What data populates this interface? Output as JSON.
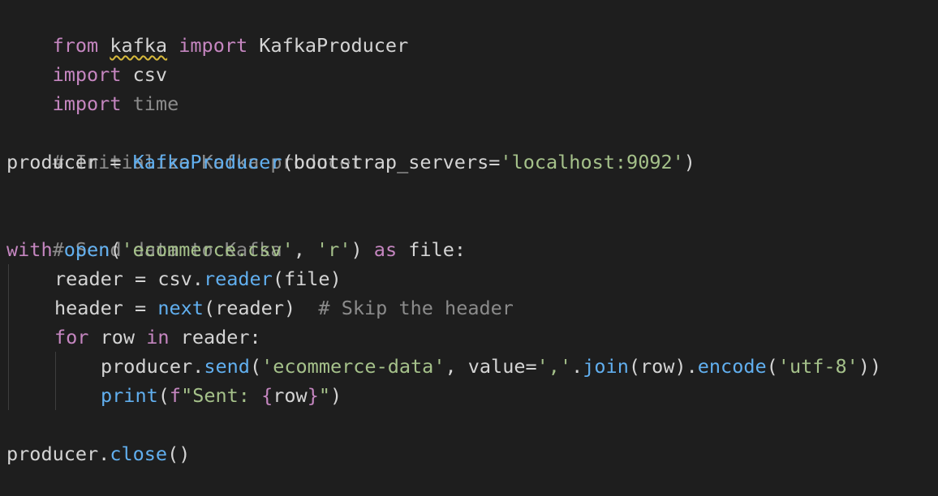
{
  "code": {
    "line1": {
      "from": "from",
      "module": "kafka",
      "import": "import",
      "name": "KafkaProducer"
    },
    "line2": {
      "import": "import",
      "module": "csv"
    },
    "line3": {
      "import": "import",
      "module": "time"
    },
    "line5": {
      "comment": "# Initialize Kafka producer"
    },
    "line6": {
      "var": "producer",
      "eq": " = ",
      "cls": "KafkaProducer",
      "open": "(",
      "arg": "bootstrap_servers",
      "eq2": "=",
      "str": "'localhost:9092'",
      "close": ")"
    },
    "line8": {
      "comment": "# Send data to Kafka"
    },
    "line9": {
      "with": "with",
      "open_fn": "open",
      "p1": "(",
      "str1": "'ecommerce.csv'",
      "comma": ", ",
      "str2": "'r'",
      "p2": ")",
      "as": "as",
      "file": "file:"
    },
    "line10": {
      "var": "reader",
      "eq": " = ",
      "obj": "csv.",
      "fn": "reader",
      "args": "(file)"
    },
    "line11": {
      "var": "header",
      "eq": " = ",
      "fn": "next",
      "args": "(reader)",
      "comment": "# Skip the header"
    },
    "line12": {
      "for": "for",
      "row": "row",
      "in": "in",
      "reader": "reader:"
    },
    "line13": {
      "obj": "producer.",
      "fn": "send",
      "p1": "(",
      "str1": "'ecommerce-data'",
      "comma": ", ",
      "kw": "value=",
      "str2": "','",
      "dot": ".",
      "join": "join",
      "args": "(row).",
      "encode": "encode",
      "p2": "(",
      "str3": "'utf-8'",
      "p3": "))"
    },
    "line14": {
      "fn": "print",
      "p1": "(",
      "f": "f",
      "str_a": "\"Sent: ",
      "brace_o": "{",
      "row": "row",
      "brace_c": "}",
      "str_b": "\"",
      "p2": ")"
    },
    "line16": {
      "obj": "producer.",
      "fn": "close",
      "args": "()"
    }
  }
}
